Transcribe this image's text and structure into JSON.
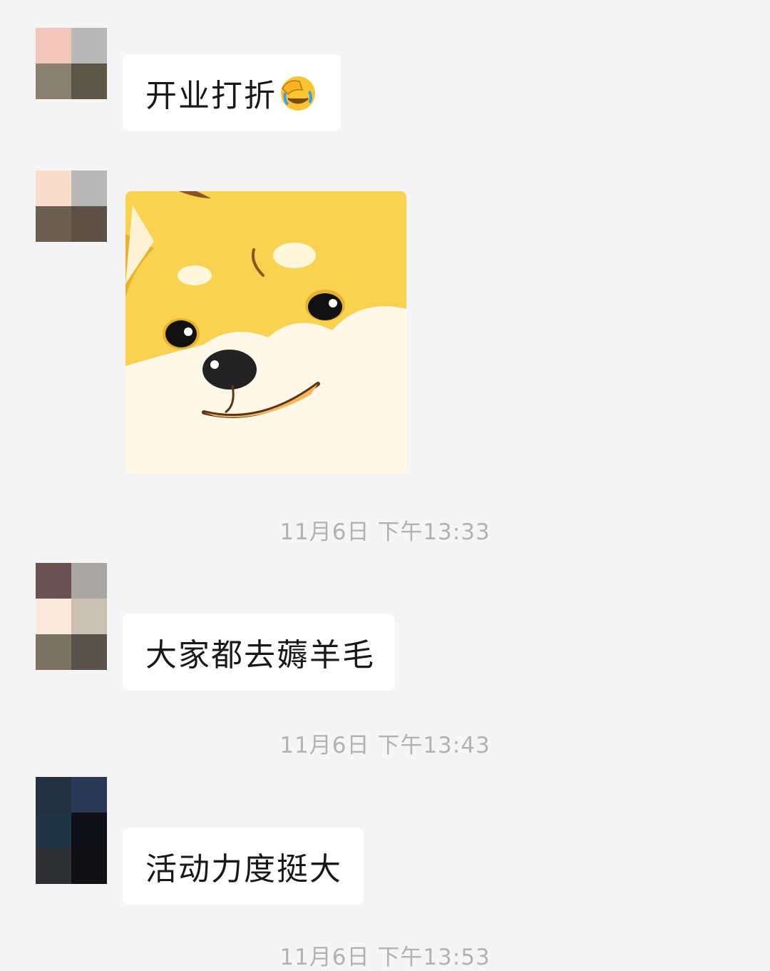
{
  "messages": [
    {
      "type": "text",
      "text": "开业打折",
      "emoji": "facepalm-laugh-emoji"
    },
    {
      "type": "sticker",
      "sticker": "shiba-inu-face-sticker"
    },
    {
      "type": "text",
      "text": "大家都去薅羊毛"
    },
    {
      "type": "text",
      "text": "活动力度挺大"
    }
  ],
  "timestamps": [
    "11月6日 下午13:33",
    "11月6日 下午13:43",
    "11月6日 下午13:53"
  ],
  "colors": {
    "background": "#f5f5f5",
    "bubble": "#ffffff",
    "message_text": "#191919",
    "timestamp_text": "#b2b2b2"
  }
}
